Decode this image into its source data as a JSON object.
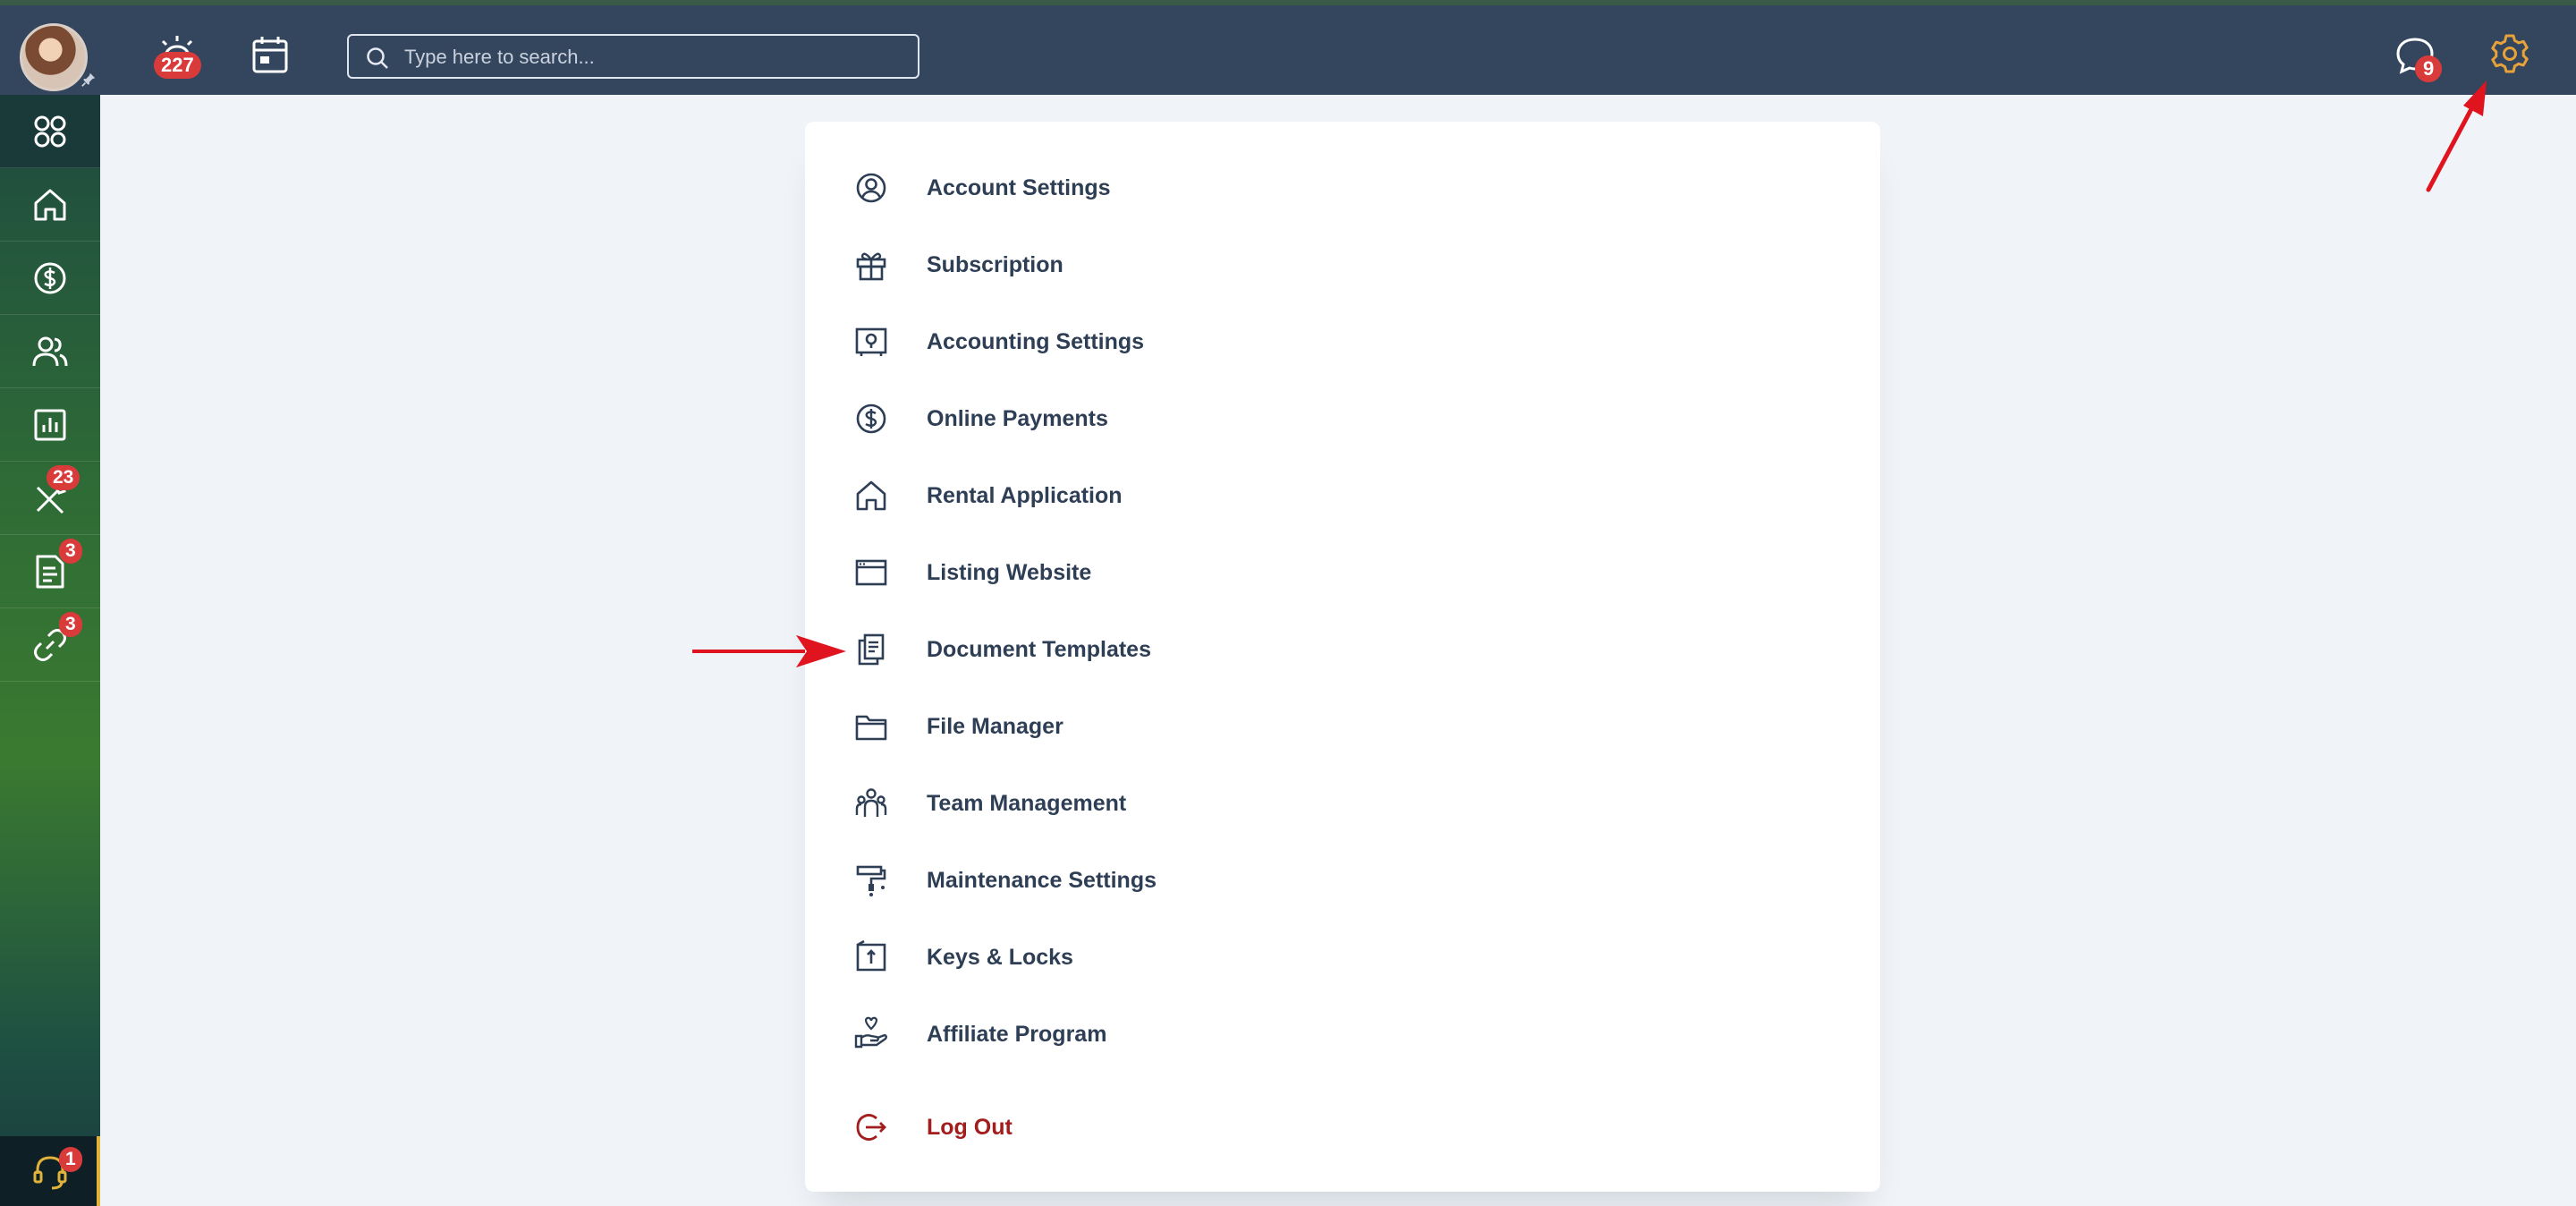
{
  "topbar": {
    "notifications_count": "227",
    "messages_count": "9",
    "search_placeholder": "Type here to search..."
  },
  "sidebar": {
    "badges": {
      "maintenance": "23",
      "documents": "3",
      "links": "3",
      "support": "1"
    }
  },
  "settings_menu": {
    "items": [
      {
        "label": "Account Settings",
        "icon": "user-circle-icon"
      },
      {
        "label": "Subscription",
        "icon": "gift-icon"
      },
      {
        "label": "Accounting Settings",
        "icon": "safe-icon"
      },
      {
        "label": "Online Payments",
        "icon": "dollar-circle-icon"
      },
      {
        "label": "Rental Application",
        "icon": "house-icon"
      },
      {
        "label": "Listing Website",
        "icon": "browser-window-icon"
      },
      {
        "label": "Document Templates",
        "icon": "documents-icon"
      },
      {
        "label": "File Manager",
        "icon": "folder-icon"
      },
      {
        "label": "Team Management",
        "icon": "team-icon"
      },
      {
        "label": "Maintenance Settings",
        "icon": "paint-roller-icon"
      },
      {
        "label": "Keys & Locks",
        "icon": "key-box-icon"
      },
      {
        "label": "Affiliate Program",
        "icon": "hand-heart-icon"
      }
    ],
    "logout_label": "Log Out"
  },
  "colors": {
    "topbar": "#34455e",
    "accent_gear": "#e8a23a",
    "badge": "#d93b3b",
    "logout": "#a21d1d",
    "annotation_arrow": "#e0141e"
  }
}
